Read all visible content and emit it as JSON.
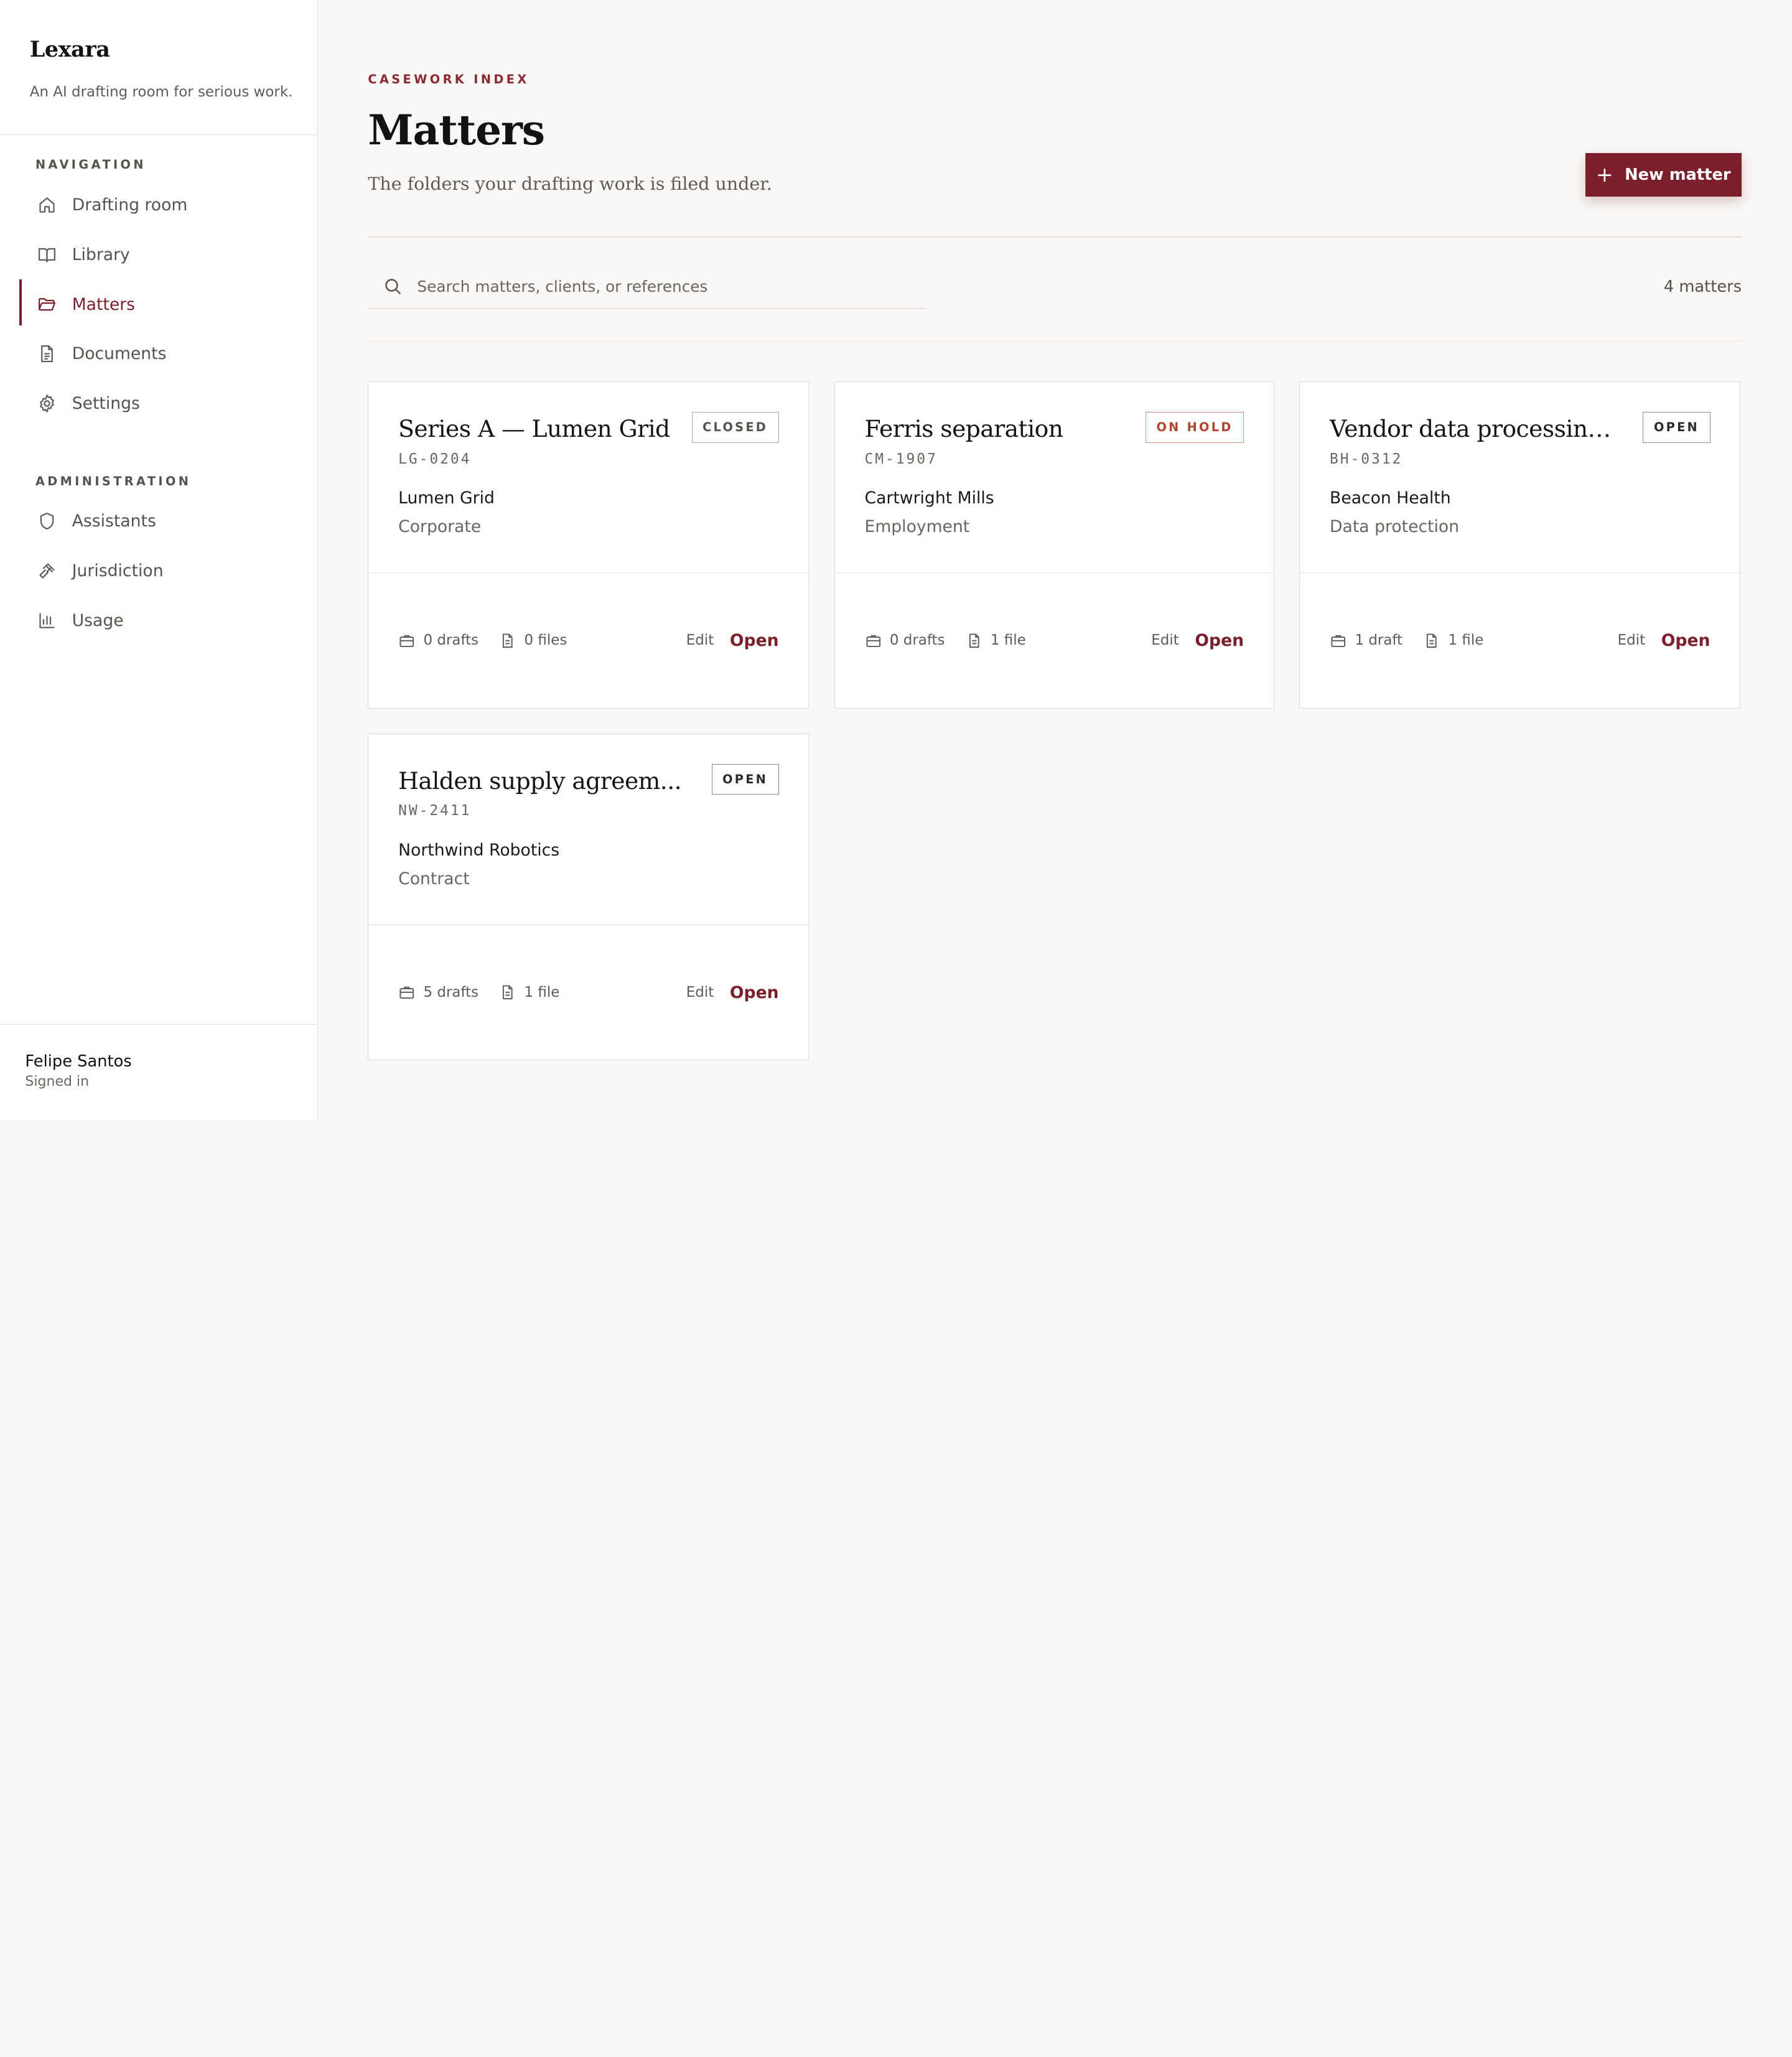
{
  "brand": {
    "name": "Lexara",
    "tagline": "An AI drafting room for serious work."
  },
  "sidebar": {
    "nav_heading": "NAVIGATION",
    "nav_items": [
      {
        "label": "Drafting room",
        "icon": "home-icon"
      },
      {
        "label": "Library",
        "icon": "book-icon"
      },
      {
        "label": "Matters",
        "icon": "folder-icon",
        "active": true
      },
      {
        "label": "Documents",
        "icon": "document-icon"
      },
      {
        "label": "Settings",
        "icon": "gear-icon"
      }
    ],
    "admin_heading": "ADMINISTRATION",
    "admin_items": [
      {
        "label": "Assistants",
        "icon": "shield-icon"
      },
      {
        "label": "Jurisdiction",
        "icon": "gavel-icon"
      },
      {
        "label": "Usage",
        "icon": "bar-chart-icon"
      }
    ],
    "user": {
      "name": "Felipe Santos",
      "status": "Signed in"
    }
  },
  "header": {
    "eyebrow": "CASEWORK INDEX",
    "title": "Matters",
    "subtitle": "The folders your drafting work is filed under.",
    "new_button": "New matter"
  },
  "search": {
    "placeholder": "Search matters, clients, or references",
    "value": ""
  },
  "count_label": "4 matters",
  "accent_color": "#7a1f2b",
  "matters": [
    {
      "title": "Series A — Lumen Grid",
      "ref": "LG-0204",
      "status": "CLOSED",
      "client": "Lumen Grid",
      "area": "Corporate",
      "drafts": "0 drafts",
      "files": "0 files",
      "edit": "Edit",
      "open": "Open"
    },
    {
      "title": "Ferris separation",
      "ref": "CM-1907",
      "status": "ON HOLD",
      "client": "Cartwright Mills",
      "area": "Employment",
      "drafts": "0 drafts",
      "files": "1 file",
      "edit": "Edit",
      "open": "Open"
    },
    {
      "title": "Vendor data processing...",
      "ref": "BH-0312",
      "status": "OPEN",
      "client": "Beacon Health",
      "area": "Data protection",
      "drafts": "1 draft",
      "files": "1 file",
      "edit": "Edit",
      "open": "Open"
    },
    {
      "title": "Halden supply agreem...",
      "ref": "NW-2411",
      "status": "OPEN",
      "client": "Northwind Robotics",
      "area": "Contract",
      "drafts": "5 drafts",
      "files": "1 file",
      "edit": "Edit",
      "open": "Open"
    }
  ]
}
